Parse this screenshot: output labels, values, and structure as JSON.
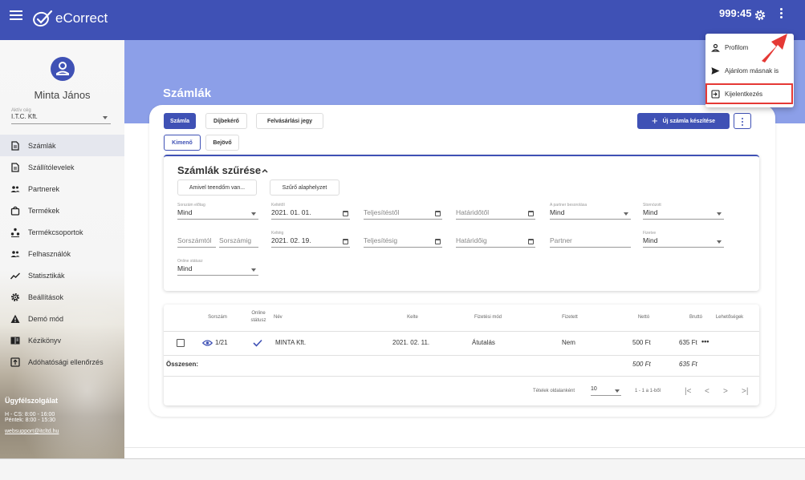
{
  "app": {
    "name": "eCorrect",
    "timer": "999:45"
  },
  "sidebar": {
    "user_name": "Minta János",
    "company_label": "Aktív cég",
    "company_value": "I.T.C. Kft.",
    "items": [
      {
        "label": "Számlák",
        "icon": "document-icon"
      },
      {
        "label": "Szállítólevelek",
        "icon": "document-icon"
      },
      {
        "label": "Partnerek",
        "icon": "people-icon"
      },
      {
        "label": "Termékek",
        "icon": "bag-icon"
      },
      {
        "label": "Termékcsoportok",
        "icon": "group-icon"
      },
      {
        "label": "Felhasználók",
        "icon": "people-icon"
      },
      {
        "label": "Statisztikák",
        "icon": "trend-icon"
      },
      {
        "label": "Beállítások",
        "icon": "gear-icon"
      },
      {
        "label": "Demó mód",
        "icon": "warning-icon"
      },
      {
        "label": "Kézikönyv",
        "icon": "book-icon"
      },
      {
        "label": "Adóhatósági ellenőrzés",
        "icon": "upload-box-icon"
      }
    ],
    "support": {
      "title": "Ügyfélszolgálat",
      "hours_1": "H - CS: 8:00 - 16:00",
      "hours_2": "Péntek: 8:00 - 15:30",
      "email": "websupport@itcltd.hu"
    }
  },
  "main": {
    "title": "Számlák",
    "tabs": [
      "Számla",
      "Díjbekérő",
      "Felvásárlási jegy"
    ],
    "subtabs": [
      "Kimenő",
      "Bejövő"
    ],
    "new_button": "Új számla készítése",
    "filter": {
      "title": "Számlák szűrése",
      "btn_todo": "Amivel teendőm van...",
      "btn_reset": "Szűrő alaphelyzet",
      "label_series": "Sorszám előtag",
      "series_value": "Mind",
      "label_from": "Keltétől",
      "date_from": "2021. 01. 01.",
      "ph_perf_from": "Teljesítéstől",
      "ph_due_from": "Határidőtől",
      "label_partner_class": "A partner besorolása",
      "partner_class_value": "Mind",
      "label_cancelled": "Stornózott",
      "cancelled_value": "Mind",
      "ph_num_from": "Sorszámtól",
      "ph_num_to": "Sorszámig",
      "label_to": "Keltéig",
      "date_to": "2021. 02. 19.",
      "ph_perf_to": "Teljesítésig",
      "ph_due_to": "Határidőig",
      "ph_partner": "Partner",
      "label_paid": "Fizetve",
      "paid_value": "Mind",
      "label_online": "Online státusz",
      "online_value": "Mind"
    },
    "table": {
      "headers": {
        "number": "Sorszám",
        "online": "Online státusz",
        "name": "Név",
        "date": "Kelte",
        "payment": "Fizetési mód",
        "paid": "Fizetett",
        "net": "Nettó",
        "gross": "Bruttó",
        "options": "Lehetőségek"
      },
      "rows": [
        {
          "number": "1/21",
          "name": "MINTA Kft.",
          "date": "2021. 02. 11.",
          "payment": "Átutalás",
          "paid": "Nem",
          "net": "500 Ft",
          "gross": "635 Ft",
          "options": "•••"
        }
      ],
      "total_label": "Összesen:",
      "total_net": "500 Ft",
      "total_gross": "635 Ft",
      "per_page_label": "Tételek oldalanként",
      "per_page_value": "10",
      "range": "1 - 1 a 1-ből"
    }
  },
  "menu": {
    "items": [
      "Profilom",
      "Ajánlom másnak is",
      "Kijelentkezés"
    ]
  },
  "colors": {
    "primary": "#3f51b5",
    "band": "#8c9fe8",
    "highlight": "#e53935"
  }
}
